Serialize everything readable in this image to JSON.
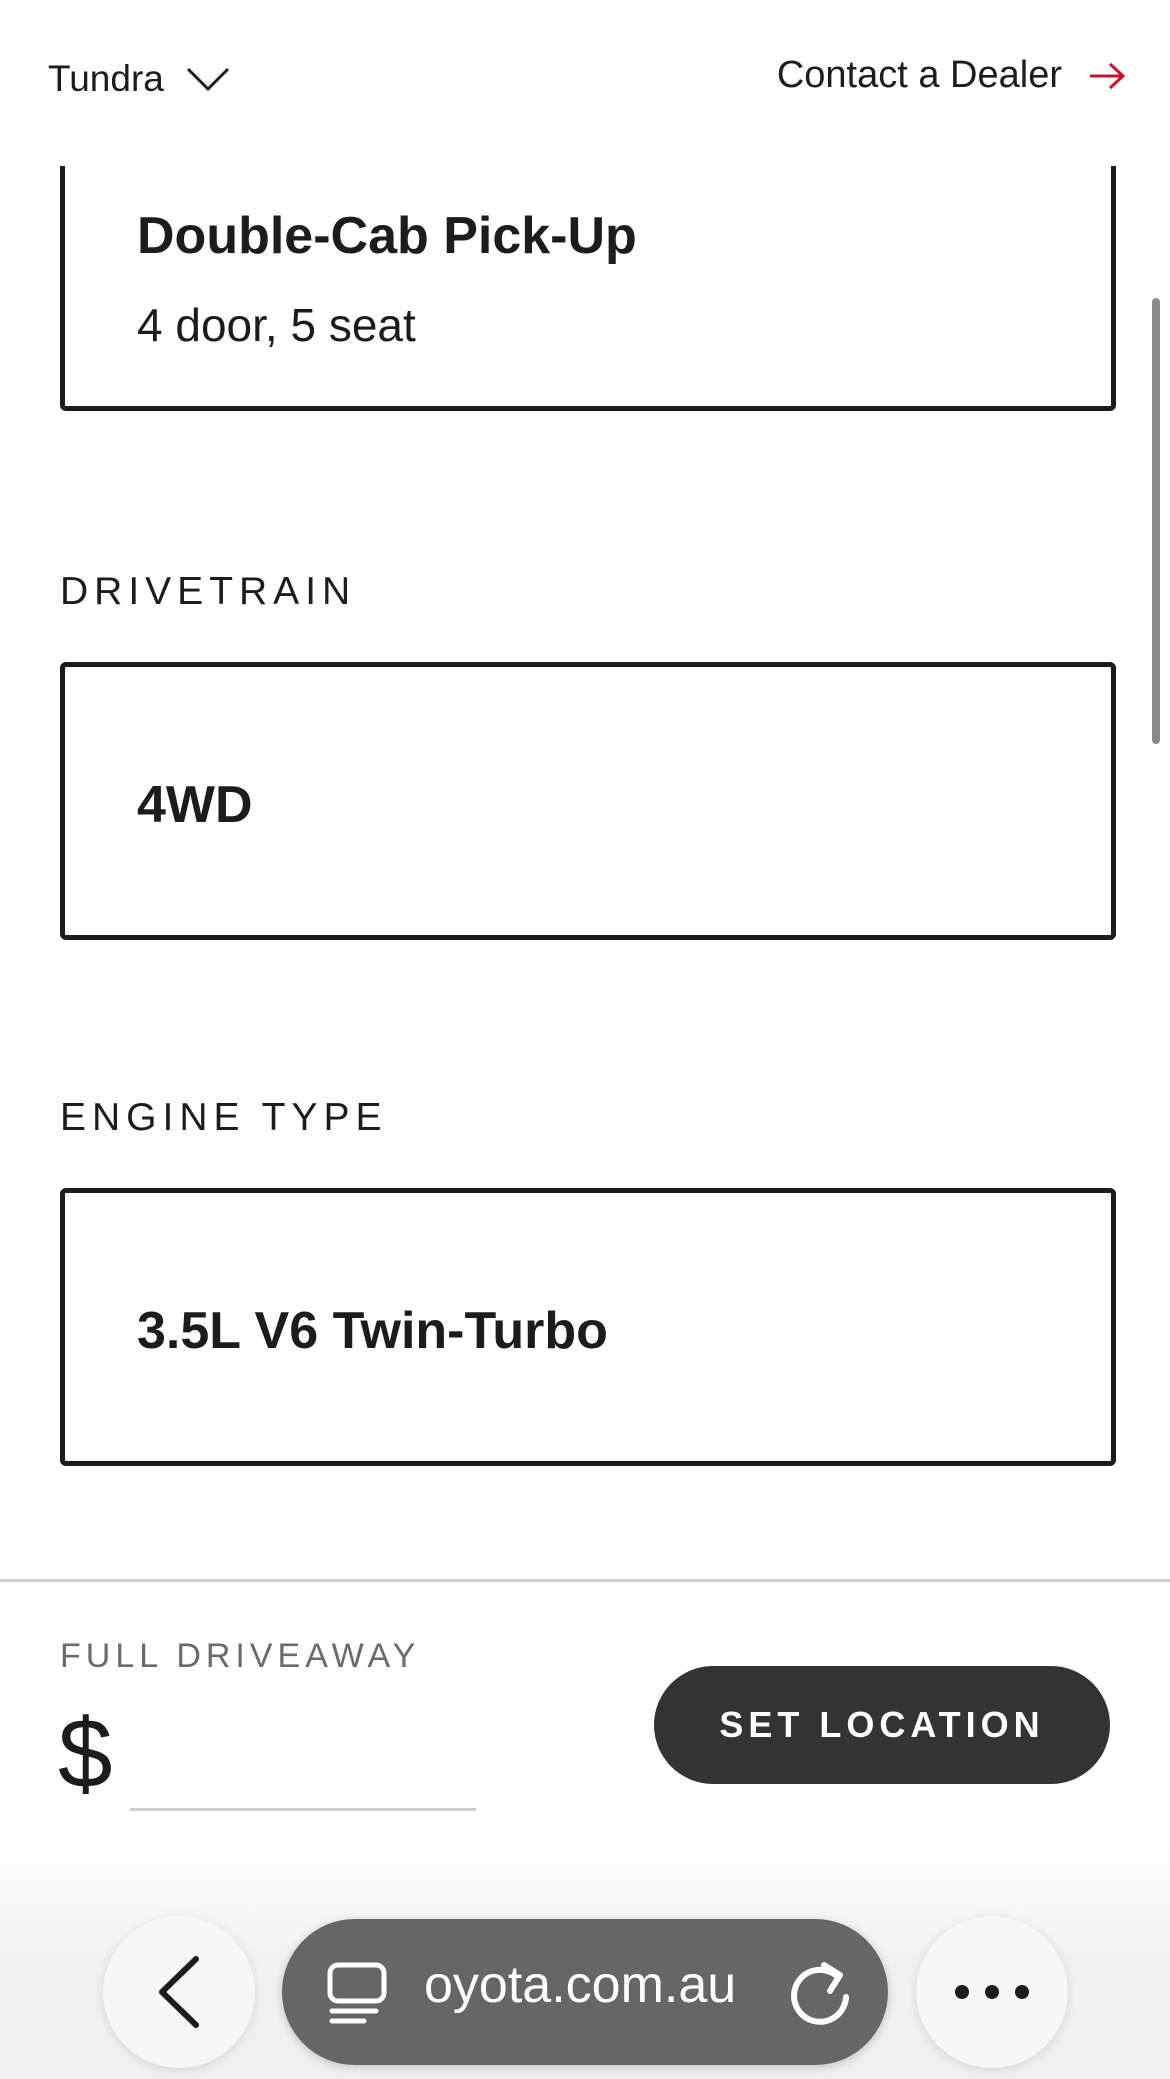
{
  "header": {
    "model": "Tundra",
    "contact_label": "Contact a Dealer",
    "accent_color": "#c8102e"
  },
  "body_style": {
    "title": "Double-Cab Pick-Up",
    "subtitle": "4 door, 5 seat"
  },
  "drivetrain": {
    "section_label": "DRIVETRAIN",
    "option": "4WD"
  },
  "engine": {
    "section_label": "ENGINE TYPE",
    "option": "3.5L V6 Twin-Turbo"
  },
  "price_bar": {
    "label": "FULL DRIVEAWAY",
    "currency": "$",
    "value": "",
    "button_label": "SET LOCATION"
  },
  "browser": {
    "url": "oyota.com.au",
    "icons": [
      "back-arrow-icon",
      "tab-overview-icon",
      "reload-icon",
      "more-icon"
    ]
  }
}
